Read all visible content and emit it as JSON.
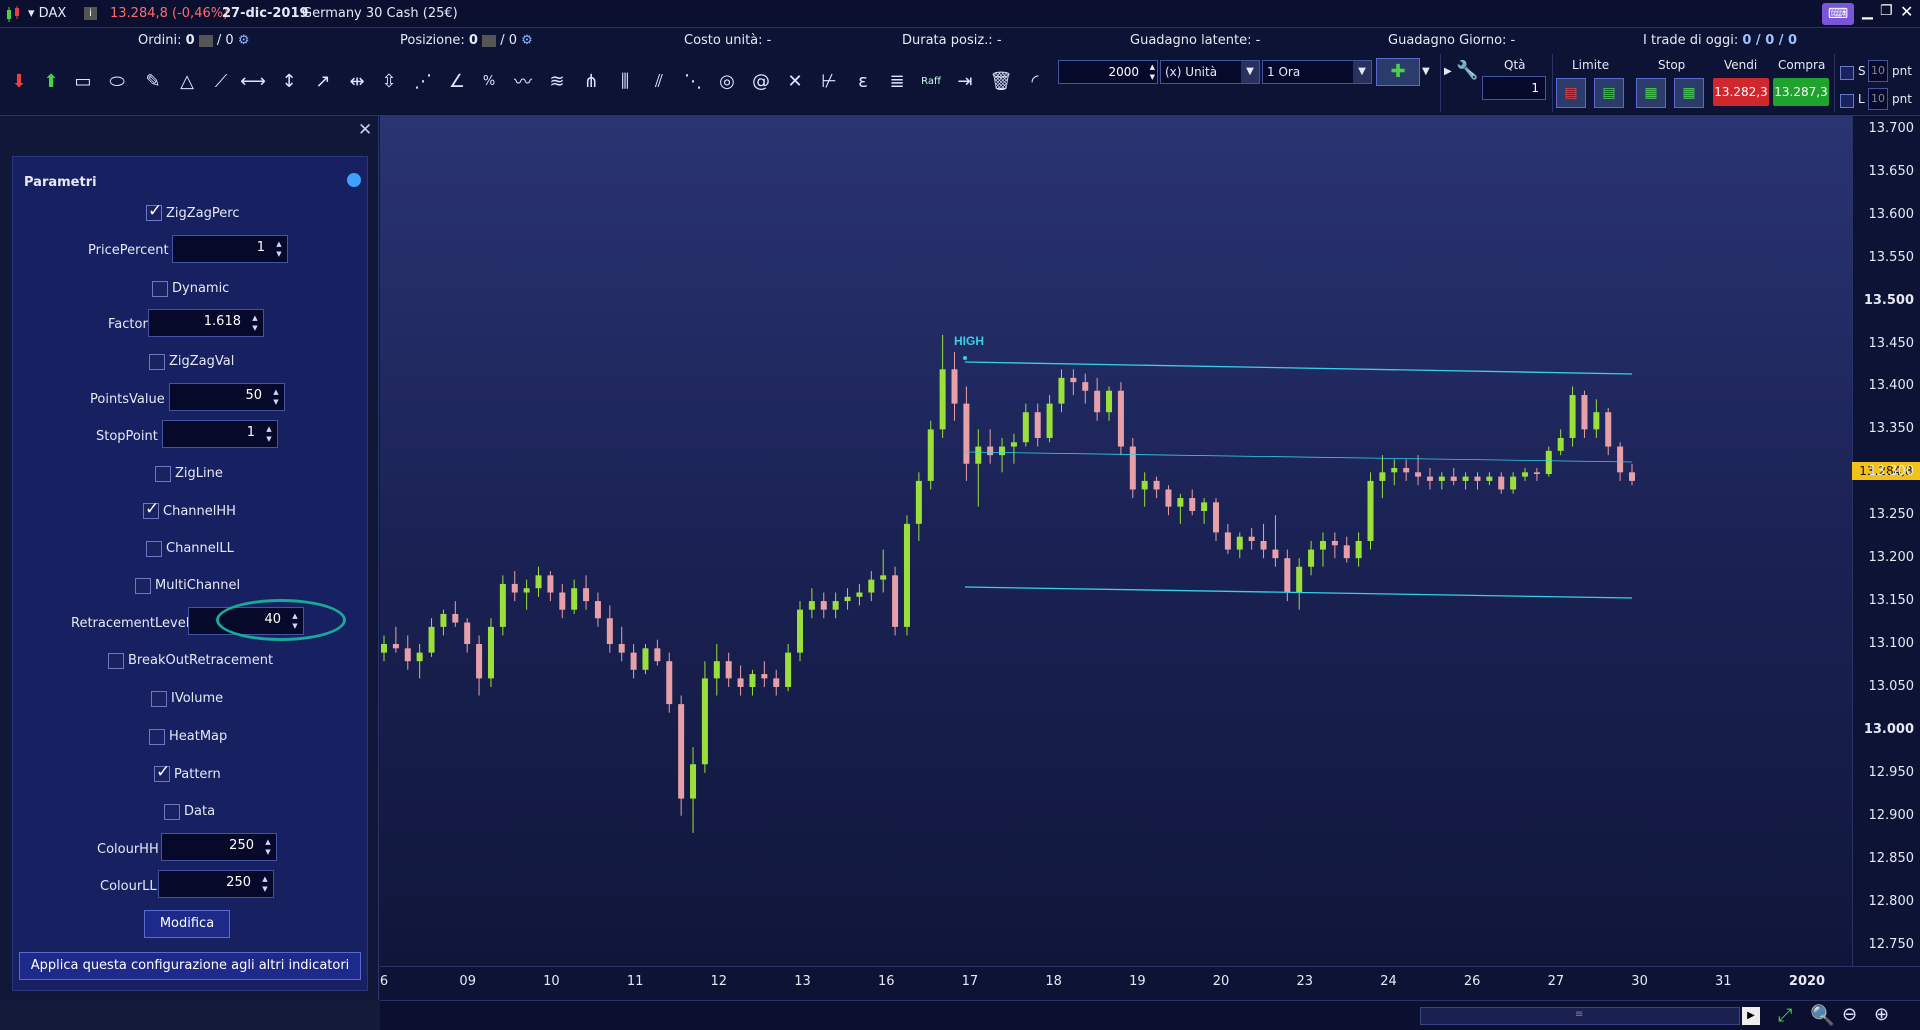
{
  "titlebar": {
    "symbol": "DAX",
    "price_change": "13.284,8 (-0,46%)",
    "date": "27-dic-2019",
    "instrument": "Germany 30 Cash (25€)"
  },
  "infobar": {
    "orders_label": "Ordini:",
    "orders_value": "0",
    "orders_total": "/ 0",
    "position_label": "Posizione:",
    "position_value": "0",
    "position_total": "/ 0",
    "unit_cost": "Costo unità: -",
    "duration": "Durata posiz.: -",
    "latent_gain": "Guadagno latente: -",
    "day_gain": "Guadagno Giorno: -",
    "trades_today_label": "I trade di oggi:",
    "trades_today_value": "0 / 0 / 0"
  },
  "toolbar": {
    "bars_value": "2000",
    "unit_select": "(x) Unità",
    "timeframe_select": "1 Ora",
    "raff_label": "Raff",
    "qty_label": "Qtà",
    "qty_value": "1",
    "limit_label": "Limite",
    "stop_label": "Stop",
    "sell_label": "Vendi",
    "sell_price": "13.282,3",
    "buy_label": "Compra",
    "buy_price": "13.287,3",
    "s_label": "S",
    "l_label": "L",
    "s_pnt": "10",
    "l_pnt": "10",
    "pnt_label": "pnt",
    "sell_color": "#d0272f",
    "buy_color": "#1fa32e"
  },
  "panel": {
    "title": "Parametri",
    "params": {
      "zigzagperc": "ZigZagPerc",
      "pricepercent_label": "PricePercent",
      "pricepercent_value": "1",
      "dynamic": "Dynamic",
      "factor_label": "Factor",
      "factor_value": "1.618",
      "zigzagval": "ZigZagVal",
      "pointsvalue_label": "PointsValue",
      "pointsvalue_value": "50",
      "stoppoint_label": "StopPoint",
      "stoppoint_value": "1",
      "zigline": "ZigLine",
      "channelhh": "ChannelHH",
      "channelll": "ChannelLL",
      "multichannel": "MultiChannel",
      "retracement_label": "RetracementLevel",
      "retracement_value": "40",
      "breakout": "BreakOutRetracement",
      "ivolume": "IVolume",
      "heatmap": "HeatMap",
      "pattern": "Pattern",
      "data": "Data",
      "colourhh_label": "ColourHH",
      "colourhh_value": "250",
      "colourll_label": "ColourLL",
      "colourll_value": "250"
    },
    "modify_button": "Modifica",
    "apply_button": "Applica questa configurazione agli altri indicatori"
  },
  "chart_data": {
    "type": "candlestick",
    "high_label": "HIGH",
    "current_price_label": "13.284,8",
    "y_ticks": [
      "13.700",
      "13.650",
      "13.600",
      "13.550",
      "13.500",
      "13.450",
      "13.400",
      "13.350",
      "13.300",
      "13.250",
      "13.200",
      "13.150",
      "13.100",
      "13.050",
      "13.000",
      "12.950",
      "12.900",
      "12.850",
      "12.800",
      "12.750"
    ],
    "ylim": [
      12725,
      13715
    ],
    "x_ticks": [
      "6",
      "09",
      "10",
      "11",
      "12",
      "13",
      "16",
      "17",
      "18",
      "19",
      "20",
      "23",
      "24",
      "26",
      "27",
      "30",
      "31",
      "2020"
    ],
    "channel_color": "#38d0e6",
    "up_color": "#9be03a",
    "down_color": "#e8a0a8",
    "bars": [
      [
        0,
        13090,
        13110,
        13080,
        13100
      ],
      [
        1,
        13100,
        13120,
        13090,
        13095
      ],
      [
        2,
        13095,
        13110,
        13070,
        13080
      ],
      [
        3,
        13080,
        13100,
        13060,
        13090
      ],
      [
        4,
        13090,
        13130,
        13085,
        13120
      ],
      [
        5,
        13120,
        13140,
        13110,
        13135
      ],
      [
        6,
        13135,
        13150,
        13120,
        13125
      ],
      [
        7,
        13125,
        13130,
        13090,
        13100
      ],
      [
        8,
        13100,
        13110,
        13040,
        13060
      ],
      [
        9,
        13060,
        13130,
        13050,
        13120
      ],
      [
        10,
        13120,
        13180,
        13110,
        13170
      ],
      [
        11,
        13170,
        13185,
        13150,
        13160
      ],
      [
        12,
        13160,
        13175,
        13140,
        13165
      ],
      [
        13,
        13165,
        13190,
        13155,
        13180
      ],
      [
        14,
        13180,
        13185,
        13150,
        13160
      ],
      [
        15,
        13160,
        13170,
        13130,
        13140
      ],
      [
        16,
        13140,
        13175,
        13135,
        13165
      ],
      [
        17,
        13165,
        13180,
        13140,
        13150
      ],
      [
        18,
        13150,
        13160,
        13120,
        13130
      ],
      [
        19,
        13130,
        13145,
        13090,
        13100
      ],
      [
        20,
        13100,
        13120,
        13080,
        13090
      ],
      [
        21,
        13090,
        13100,
        13060,
        13070
      ],
      [
        22,
        13070,
        13100,
        13065,
        13095
      ],
      [
        23,
        13095,
        13105,
        13075,
        13080
      ],
      [
        24,
        13080,
        13090,
        13020,
        13030
      ],
      [
        25,
        13030,
        13040,
        12900,
        12920
      ],
      [
        26,
        12920,
        12980,
        12880,
        12960
      ],
      [
        27,
        12960,
        13080,
        12950,
        13060
      ],
      [
        28,
        13060,
        13100,
        13040,
        13080
      ],
      [
        29,
        13080,
        13090,
        13050,
        13060
      ],
      [
        30,
        13060,
        13075,
        13040,
        13050
      ],
      [
        31,
        13050,
        13070,
        13040,
        13065
      ],
      [
        32,
        13065,
        13080,
        13050,
        13060
      ],
      [
        33,
        13060,
        13070,
        13040,
        13050
      ],
      [
        34,
        13050,
        13100,
        13045,
        13090
      ],
      [
        35,
        13090,
        13150,
        13080,
        13140
      ],
      [
        36,
        13140,
        13165,
        13130,
        13150
      ],
      [
        37,
        13150,
        13160,
        13130,
        13140
      ],
      [
        38,
        13140,
        13160,
        13130,
        13150
      ],
      [
        39,
        13150,
        13165,
        13140,
        13155
      ],
      [
        40,
        13155,
        13170,
        13145,
        13160
      ],
      [
        41,
        13160,
        13185,
        13150,
        13175
      ],
      [
        42,
        13175,
        13210,
        13160,
        13180
      ],
      [
        43,
        13180,
        13190,
        13110,
        13120
      ],
      [
        44,
        13120,
        13250,
        13110,
        13240
      ],
      [
        45,
        13240,
        13300,
        13220,
        13290
      ],
      [
        46,
        13290,
        13360,
        13280,
        13350
      ],
      [
        47,
        13350,
        13460,
        13340,
        13420
      ],
      [
        48,
        13420,
        13440,
        13360,
        13380
      ],
      [
        49,
        13380,
        13400,
        13290,
        13310
      ],
      [
        50,
        13310,
        13350,
        13260,
        13330
      ],
      [
        51,
        13330,
        13350,
        13310,
        13320
      ],
      [
        52,
        13320,
        13340,
        13300,
        13330
      ],
      [
        53,
        13330,
        13345,
        13310,
        13335
      ],
      [
        54,
        13335,
        13380,
        13330,
        13370
      ],
      [
        55,
        13370,
        13380,
        13330,
        13340
      ],
      [
        56,
        13340,
        13390,
        13335,
        13380
      ],
      [
        57,
        13380,
        13420,
        13370,
        13410
      ],
      [
        58,
        13410,
        13420,
        13390,
        13405
      ],
      [
        59,
        13405,
        13415,
        13380,
        13395
      ],
      [
        60,
        13395,
        13410,
        13360,
        13370
      ],
      [
        61,
        13370,
        13400,
        13360,
        13395
      ],
      [
        62,
        13395,
        13405,
        13320,
        13330
      ],
      [
        63,
        13330,
        13340,
        13270,
        13280
      ],
      [
        64,
        13280,
        13300,
        13260,
        13290
      ],
      [
        65,
        13290,
        13295,
        13270,
        13280
      ],
      [
        66,
        13280,
        13285,
        13250,
        13260
      ],
      [
        67,
        13260,
        13275,
        13240,
        13270
      ],
      [
        68,
        13270,
        13280,
        13250,
        13255
      ],
      [
        69,
        13255,
        13270,
        13240,
        13265
      ],
      [
        70,
        13265,
        13270,
        13220,
        13230
      ],
      [
        71,
        13230,
        13240,
        13205,
        13210
      ],
      [
        72,
        13210,
        13230,
        13200,
        13225
      ],
      [
        73,
        13225,
        13235,
        13210,
        13220
      ],
      [
        74,
        13220,
        13240,
        13200,
        13210
      ],
      [
        75,
        13210,
        13250,
        13190,
        13200
      ],
      [
        76,
        13200,
        13210,
        13150,
        13160
      ],
      [
        77,
        13160,
        13200,
        13140,
        13190
      ],
      [
        78,
        13190,
        13220,
        13180,
        13210
      ],
      [
        79,
        13210,
        13230,
        13190,
        13220
      ],
      [
        80,
        13220,
        13230,
        13200,
        13215
      ],
      [
        81,
        13215,
        13225,
        13195,
        13200
      ],
      [
        82,
        13200,
        13230,
        13190,
        13220
      ],
      [
        83,
        13220,
        13300,
        13210,
        13290
      ],
      [
        84,
        13290,
        13320,
        13270,
        13300
      ],
      [
        85,
        13300,
        13315,
        13285,
        13305
      ],
      [
        86,
        13305,
        13315,
        13290,
        13300
      ],
      [
        87,
        13300,
        13320,
        13285,
        13295
      ],
      [
        88,
        13295,
        13305,
        13280,
        13290
      ],
      [
        89,
        13290,
        13300,
        13280,
        13295
      ],
      [
        90,
        13295,
        13305,
        13285,
        13290
      ],
      [
        91,
        13290,
        13300,
        13280,
        13295
      ],
      [
        92,
        13295,
        13300,
        13280,
        13290
      ],
      [
        93,
        13290,
        13300,
        13285,
        13295
      ],
      [
        94,
        13295,
        13300,
        13275,
        13280
      ],
      [
        95,
        13280,
        13300,
        13275,
        13295
      ],
      [
        96,
        13295,
        13305,
        13290,
        13300
      ],
      [
        97,
        13300,
        13305,
        13290,
        13298
      ],
      [
        98,
        13298,
        13330,
        13295,
        13325
      ],
      [
        99,
        13325,
        13350,
        13320,
        13340
      ],
      [
        100,
        13340,
        13400,
        13330,
        13390
      ],
      [
        101,
        13390,
        13395,
        13340,
        13350
      ],
      [
        102,
        13350,
        13385,
        13340,
        13370
      ],
      [
        103,
        13370,
        13375,
        13320,
        13330
      ],
      [
        104,
        13330,
        13335,
        13290,
        13300
      ],
      [
        105,
        13300,
        13310,
        13285,
        13290
      ]
    ]
  }
}
